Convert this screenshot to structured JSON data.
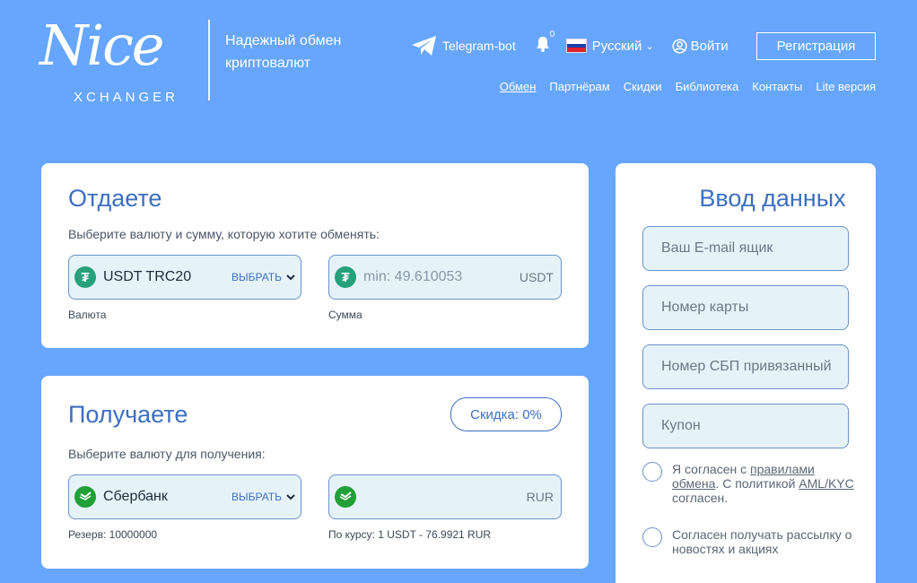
{
  "header": {
    "logo_text": "Nice",
    "logo_subtext": "XCHANGER",
    "tagline": "Надежный обмен криптовалют",
    "telegram_label": "Telegram-bot",
    "notifications_count": "0",
    "language": "Русский",
    "login_label": "Войти",
    "register_label": "Регистрация"
  },
  "nav": {
    "items": [
      "Обмен",
      "Партнёрам",
      "Скидки",
      "Библиотека",
      "Контакты",
      "Lite версия"
    ]
  },
  "give": {
    "title": "Отдаете",
    "hint": "Выберите валюту и сумму, которую хотите обменять:",
    "currency_name": "USDT TRC20",
    "choose_label": "ВЫБРАТЬ",
    "amount_placeholder": "min: 49.610053",
    "amount_currency": "USDT",
    "currency_caption": "Валюта",
    "amount_caption": "Сумма"
  },
  "get": {
    "title": "Получаете",
    "discount_label": "Скидка: 0%",
    "hint": "Выберите валюту для получения:",
    "currency_name": "Сбербанк",
    "choose_label": "ВЫБРАТЬ",
    "amount_currency": "RUR",
    "reserve_caption": "Резерв: 10000000",
    "rate_caption": "По курсу: 1 USDT - 76.9921 RUR"
  },
  "form": {
    "title": "Ввод данных",
    "email_placeholder": "Ваш E-mail ящик",
    "card_placeholder": "Номер карты",
    "sbp_placeholder": "Номер СБП привязанный",
    "coupon_placeholder": "Купон",
    "agree_prefix": "Я согласен с ",
    "agree_link": "правилами обмена",
    "agree_middle": ". С политикой ",
    "agree_link2": "AML/KYC",
    "agree_suffix": " согласен.",
    "newsletter_text": "Согласен получать рассылку о новостях и акциях"
  },
  "colors": {
    "background": "#66a6ff",
    "accent": "#3d6fc1",
    "tether": "#26a17b",
    "sber": "#21a038"
  },
  "icons": [
    "telegram-icon",
    "bell-icon",
    "russia-flag-icon",
    "chevron-down-icon",
    "user-icon",
    "tether-icon",
    "sberbank-icon"
  ]
}
